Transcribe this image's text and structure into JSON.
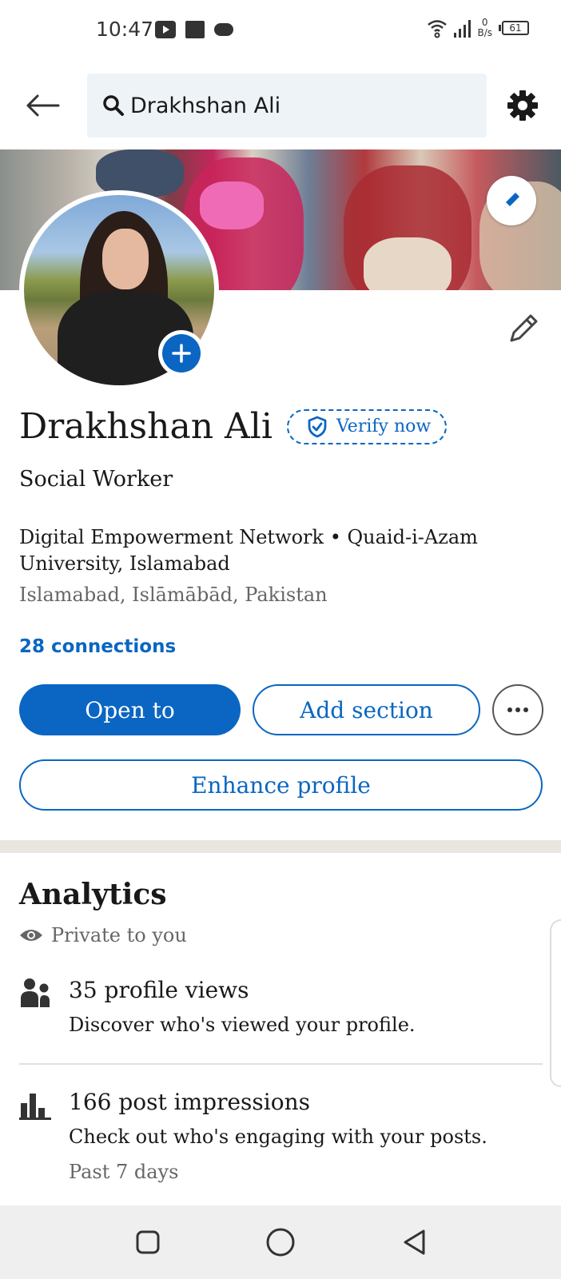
{
  "status_bar": {
    "time": "10:47",
    "net_speed_value": "0",
    "net_speed_unit": "B/s",
    "battery": "61"
  },
  "top_bar": {
    "search_value": "Drakhshan Ali"
  },
  "profile": {
    "name": "Drakhshan Ali",
    "verify_label": "Verify now",
    "headline": "Social Worker",
    "organization": "Digital Empowerment Network • Quaid-i-Azam University, Islamabad",
    "location": "Islamabad, Islāmābād, Pakistan",
    "connections": "28 connections"
  },
  "actions": {
    "open_to": "Open to",
    "add_section": "Add section",
    "enhance_profile": "Enhance profile"
  },
  "analytics": {
    "title": "Analytics",
    "privacy": "Private to you",
    "items": [
      {
        "title": "35 profile views",
        "subtitle": "Discover who's viewed your profile.",
        "icon": "people-icon"
      },
      {
        "title": "166 post impressions",
        "subtitle": "Check out who's engaging with your posts.",
        "note": "Past 7 days",
        "icon": "bar-chart-icon"
      }
    ]
  },
  "colors": {
    "accent": "#0a66c2",
    "text_primary": "#191919",
    "text_secondary": "#666666",
    "search_bg": "#eef3f8"
  }
}
